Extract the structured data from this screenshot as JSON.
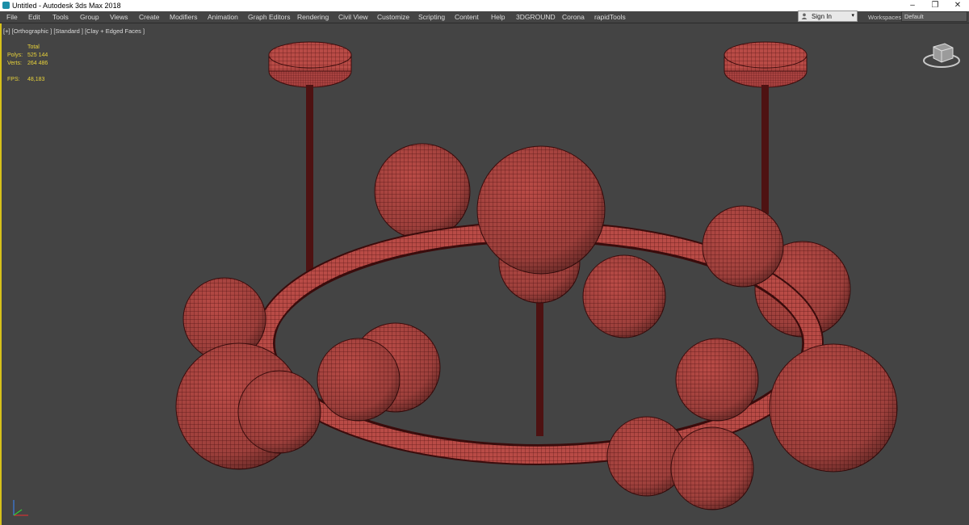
{
  "window": {
    "title": "Untitled - Autodesk 3ds Max 2018",
    "minimize": "–",
    "restore": "❐",
    "close": "✕"
  },
  "menu": [
    "File",
    "Edit",
    "Tools",
    "Group",
    "Views",
    "Create",
    "Modifiers",
    "Animation",
    "Graph Editors",
    "Rendering",
    "Civil View",
    "Customize",
    "Scripting",
    "Content",
    "Help",
    "3DGROUND",
    "Corona",
    "rapidTools"
  ],
  "account": {
    "sign_in": "Sign In",
    "caret": "▾"
  },
  "workspaces": {
    "label": "Workspaces:",
    "value": "Default"
  },
  "viewport": {
    "label": "[+] [Orthographic ] [Standard ] [Clay + Edged Faces ]"
  },
  "stats": {
    "header": "Total",
    "polys_label": "Polys:",
    "polys": "525 144",
    "verts_label": "Verts:",
    "verts": "264 486",
    "fps_label": "FPS:",
    "fps": "48,183"
  },
  "colors": {
    "viewport_bg": "#444444",
    "mesh": "#b84a45",
    "wire": "#5a1616",
    "stats": "#e8d23a",
    "active_border": "#d7c11a"
  },
  "icons": {
    "app": "3dsmax-icon",
    "account": "user-icon",
    "axis": "axis-tripod-icon",
    "navigation": "viewcube-icon"
  }
}
